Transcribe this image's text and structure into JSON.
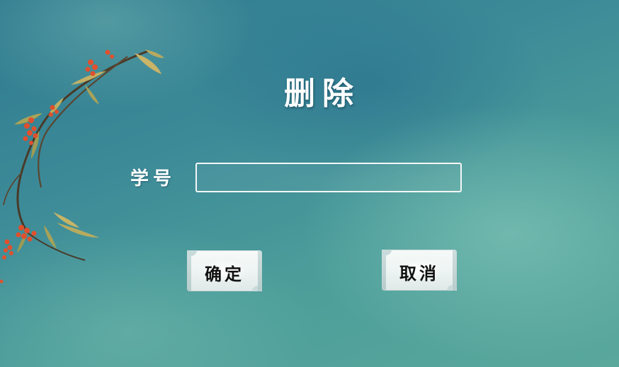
{
  "dialog": {
    "title": "删除",
    "student_id_label": "学号",
    "student_id_value": "",
    "student_id_placeholder": "",
    "confirm_label": "确定",
    "cancel_label": "取消"
  },
  "decoration": {
    "branch_icon": "bamboo-branch-with-red-berries",
    "colors": {
      "background_dark": "#2f7a8f",
      "background_light": "#5aa89c",
      "berry": "#e0502c",
      "leaf": "#c8b66a",
      "text": "#ffffff"
    }
  }
}
